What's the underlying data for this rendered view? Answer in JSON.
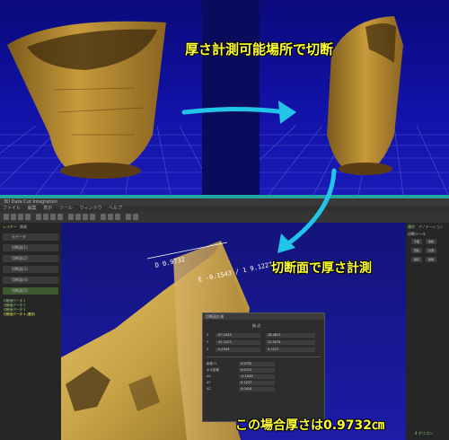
{
  "captions": {
    "top": "厚さ計測可能場所で切断",
    "middle": "切断面で厚さ計測",
    "bottom": "この場合厚さは0.9732㎝"
  },
  "measurement": {
    "line1": "D  0.9732",
    "line2": "E  -0.1543 / 1  9.1227"
  },
  "app": {
    "title": "3D Data Cut Integration",
    "menu": [
      "ファイル",
      "編集",
      "表示",
      "ツール",
      "ウィンドウ",
      "ヘルプ"
    ],
    "left_tabs": [
      "レイヤー",
      "情報"
    ],
    "left_items": [
      "元データ",
      "切断面(1)",
      "切断面(2)",
      "切断面(3)",
      "切断面(4)",
      "切断面(5)"
    ],
    "left_list": [
      "切断面データ 1",
      "切断面データ 2",
      "切断面データ 3",
      "切断面データ 4 (選択)"
    ],
    "right_tabs": [
      "操作",
      "アノテーション"
    ],
    "right_section": "切断ツール",
    "right_buttons": [
      "平面",
      "移動",
      "回転",
      "計測",
      "保存",
      "削除"
    ],
    "right_status": "4 ポリゴン",
    "dialog": {
      "title": "切断面計測",
      "header": "始 点",
      "rows": [
        {
          "label": "X",
          "a": "-87.1543",
          "b": "18.4813"
        },
        {
          "label": "Y",
          "a": "-91.1227",
          "b": "12.5074"
        },
        {
          "label": "Z",
          "a": "-0.1543",
          "b": "9.1227"
        }
      ],
      "results": [
        {
          "label": "距離 D",
          "value": "0.9732"
        },
        {
          "label": "水平距離",
          "value": "0.9721"
        },
        {
          "label": "ΔX",
          "value": "-0.1543"
        },
        {
          "label": "ΔY",
          "value": "9.1227"
        },
        {
          "label": "ΔZ",
          "value": "0.0410"
        }
      ]
    }
  },
  "colors": {
    "viewport_top": "#0a0a7a",
    "arrow": "#22c5e8",
    "caption": "#ffff33",
    "accent": "#21a6a0"
  }
}
